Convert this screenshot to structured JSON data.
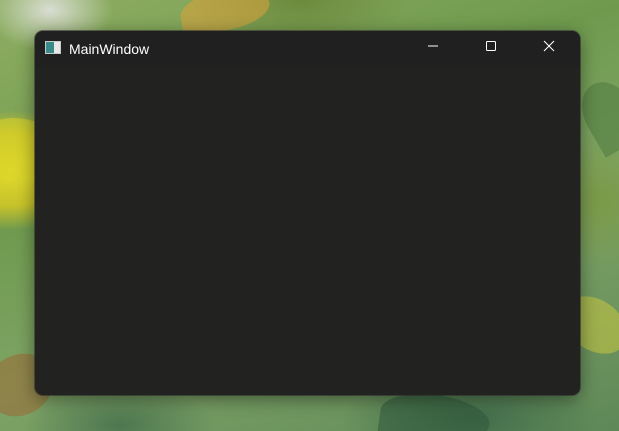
{
  "window": {
    "title": "MainWindow",
    "background_color": "#222320",
    "titlebar_color": "#202020"
  },
  "titlebar": {
    "app_icon": "app-window-icon",
    "buttons": [
      {
        "name": "minimize",
        "icon": "minimize-icon"
      },
      {
        "name": "maximize",
        "icon": "maximize-icon"
      },
      {
        "name": "close",
        "icon": "close-icon"
      }
    ]
  }
}
